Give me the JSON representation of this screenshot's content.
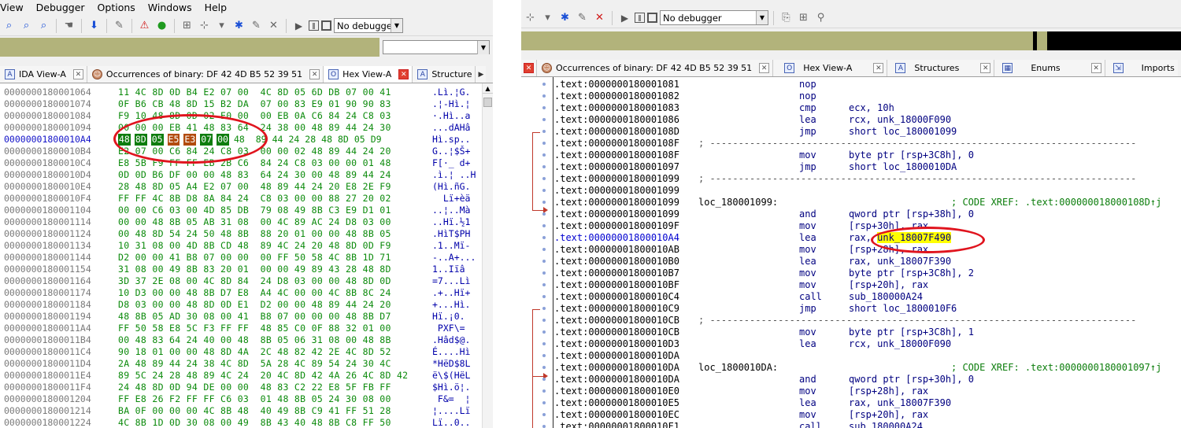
{
  "left": {
    "menu": [
      "View",
      "Debugger",
      "Options",
      "Windows",
      "Help"
    ],
    "debugger_select": "No debugger",
    "tabs": [
      {
        "label": "IDA View-A",
        "icon": "A"
      },
      {
        "label": "Occurrences of binary: DF 42 4D B5 52 39 51",
        "icon": "face"
      },
      {
        "label": "Hex View-A",
        "icon": "H"
      },
      {
        "label": "Structure",
        "icon": "A"
      }
    ],
    "hex_rows": [
      {
        "addr": "0000000180001064",
        "bytes": "11 4C 8D 0D B4 E2 07 00  4C 8D 05 6D DB 07 00 41",
        "ascii": ".Lì.¦G."
      },
      {
        "addr": "0000000180001074",
        "bytes": "0F B6 CB 48 8D 15 B2 DA  07 00 83 E9 01 90 90 83",
        "ascii": ".¦-Hì.¦"
      },
      {
        "addr": "0000000180001084",
        "bytes": "F9 10 48 8D 0D 02 E0 00  00 EB 0A C6 84 24 C8 03",
        "ascii": "·.Hì..a"
      },
      {
        "addr": "0000000180001094",
        "bytes": "00 00 00 EB 41 48 83 64  24 38 00 48 89 44 24 30",
        "ascii": "...dAHâ"
      },
      {
        "addr": "00000001800010A4",
        "bytes": "48 8D 05 E5 E3 07 00 48  89 44 24 28 48 8D 05 D9",
        "ascii": "Hì.sp..",
        "selected": true
      },
      {
        "addr": "00000001800010B4",
        "bytes": "E2 07 00 C6 84 24 C8 03  00 00 02 48 89 44 24 20",
        "ascii": "G..¦$Š+"
      },
      {
        "addr": "00000001800010C4",
        "bytes": "E8 5B F9 FF FF EB 2B C6  84 24 C8 03 00 00 01 48",
        "ascii": "F[·_ d+"
      },
      {
        "addr": "00000001800010D4",
        "bytes": "0D 0D B6 DF 00 00 48 83  64 24 30 00 48 89 44 24",
        "ascii": ".ì.¦ ..H"
      },
      {
        "addr": "00000001800010E4",
        "bytes": "28 48 8D 05 A4 E2 07 00  48 89 44 24 20 E8 2E F9",
        "ascii": "(Hì.ñG."
      },
      {
        "addr": "00000001800010F4",
        "bytes": "FF FF 4C 8B D8 8A 84 24  C8 03 00 00 88 27 20 02",
        "ascii": "  Lï+èä"
      },
      {
        "addr": "0000000180001104",
        "bytes": "00 00 C6 03 00 4D 85 DB  79 08 49 8B C3 E9 D1 01",
        "ascii": "..¦..Mà"
      },
      {
        "addr": "0000000180001114",
        "bytes": "00 00 48 8B 05 AB 31 08  00 4C 89 AC 24 D8 03 00",
        "ascii": "..Hï.½1"
      },
      {
        "addr": "0000000180001124",
        "bytes": "00 48 8D 54 24 50 48 8B  88 20 01 00 00 48 8B 05",
        "ascii": ".HìT$PH"
      },
      {
        "addr": "0000000180001134",
        "bytes": "10 31 08 00 4D 8B CD 48  89 4C 24 20 48 8D 0D F9",
        "ascii": ".1..Mï-"
      },
      {
        "addr": "0000000180001144",
        "bytes": "D2 00 00 41 B8 07 00 00  00 FF 50 58 4C 8B 1D 71",
        "ascii": "-..A+..."
      },
      {
        "addr": "0000000180001154",
        "bytes": "31 08 00 49 8B 83 20 01  00 00 49 89 43 28 48 8D",
        "ascii": "1..Iïâ"
      },
      {
        "addr": "0000000180001164",
        "bytes": "3D 37 2E 08 00 4C 8D 84  24 D8 03 00 00 48 8D 0D",
        "ascii": "=7...Lì"
      },
      {
        "addr": "0000000180001174",
        "bytes": "10 D3 00 00 48 8B D7 E8  A4 4C 00 00 4C 8B 8C 24",
        "ascii": ".+..Hï+"
      },
      {
        "addr": "0000000180001184",
        "bytes": "D8 03 00 00 48 8D 0D E1  D2 00 00 48 89 44 24 20",
        "ascii": "+...Hì."
      },
      {
        "addr": "0000000180001194",
        "bytes": "48 8B 05 AD 30 08 00 41  B8 07 00 00 00 48 8B D7",
        "ascii": "Hï.¡0."
      },
      {
        "addr": "00000001800011A4",
        "bytes": "FF 50 58 E8 5C F3 FF FF  48 85 C0 0F 88 32 01 00",
        "ascii": " PXF\\="
      },
      {
        "addr": "00000001800011B4",
        "bytes": "00 48 83 64 24 40 00 48  8B 05 06 31 08 00 48 8B",
        "ascii": ".Hâd$@."
      },
      {
        "addr": "00000001800011C4",
        "bytes": "90 18 01 00 00 48 8D 4A  2C 48 82 42 2E 4C 8D 52",
        "ascii": "É....Hì"
      },
      {
        "addr": "00000001800011D4",
        "bytes": "2A 48 89 44 24 38 4C 8D  5A 28 4C 89 54 24 30 4C",
        "ascii": "*HëD$8L"
      },
      {
        "addr": "00000001800011E4",
        "bytes": "89 5C 24 28 48 89 4C 24  20 4C 8D 42 4A 26 4C 8D 42",
        "ascii": "ë\\$(HëL"
      },
      {
        "addr": "00000001800011F4",
        "bytes": "24 48 8D 0D 94 DE 00 00  48 83 C2 22 E8 5F FB FF",
        "ascii": "$Hì.ö¦."
      },
      {
        "addr": "0000000180001204",
        "bytes": "FF E8 26 F2 FF FF C6 03  01 48 8B 05 24 30 08 00",
        "ascii": " F&=  ¦"
      },
      {
        "addr": "0000000180001214",
        "bytes": "BA 0F 00 00 00 4C 8B 48  40 49 8B C9 41 FF 51 28",
        "ascii": "¦....Lï"
      },
      {
        "addr": "0000000180001224",
        "bytes": "4C 8B 1D 0D 30 08 00 49  8B 43 40 48 8B C8 FF 50",
        "ascii": "Lï..0.."
      }
    ]
  },
  "right": {
    "debugger_select": "No debugger",
    "tabs": [
      {
        "label": "Occurrences of binary: DF 42 4D B5 52 39 51",
        "icon": "face"
      },
      {
        "label": "Hex View-A",
        "icon": "O"
      },
      {
        "label": "Structures",
        "icon": "A"
      },
      {
        "label": "Enums",
        "icon": "grid"
      },
      {
        "label": "Imports",
        "icon": "imp"
      }
    ],
    "disasm_rows": [
      {
        "addr": ".text:0000000180001081",
        "mnem": "nop",
        "ops": ""
      },
      {
        "addr": ".text:0000000180001082",
        "mnem": "nop",
        "ops": ""
      },
      {
        "addr": ".text:0000000180001083",
        "mnem": "cmp",
        "ops": "ecx, 10h"
      },
      {
        "addr": ".text:0000000180001086",
        "mnem": "lea",
        "ops": "rcx, unk_18000F090"
      },
      {
        "addr": ".text:000000018000108D",
        "mnem": "jmp",
        "ops": "short loc_180001099"
      },
      {
        "addr": ".text:000000018000108F",
        "sep": "; ---------------------------------------------------------------------------"
      },
      {
        "addr": ".text:000000018000108F",
        "mnem": "mov",
        "ops": "byte ptr [rsp+3C8h], 0"
      },
      {
        "addr": ".text:0000000180001097",
        "mnem": "jmp",
        "ops": "short loc_1800010DA"
      },
      {
        "addr": ".text:0000000180001099",
        "sep": "; ---------------------------------------------------------------------------"
      },
      {
        "addr": ".text:0000000180001099",
        "mnem": "",
        "ops": ""
      },
      {
        "addr": ".text:0000000180001099",
        "label": "loc_180001099:",
        "comment": "; CODE XREF: .text:000000018000108D↑j"
      },
      {
        "addr": ".text:0000000180001099",
        "mnem": "and",
        "ops": "qword ptr [rsp+38h], 0"
      },
      {
        "addr": ".text:000000018000109F",
        "mnem": "mov",
        "ops": "[rsp+30h], rax"
      },
      {
        "addr": ".text:00000001800010A4",
        "mnem": "lea",
        "ops_pre": "rax, ",
        "ops_hl": "unk_18007F490",
        "current": true
      },
      {
        "addr": ".text:00000001800010AB",
        "mnem": "mov",
        "ops": "[rsp+28h], rax"
      },
      {
        "addr": ".text:00000001800010B0",
        "mnem": "lea",
        "ops": "rax, unk_18007F390"
      },
      {
        "addr": ".text:00000001800010B7",
        "mnem": "mov",
        "ops": "byte ptr [rsp+3C8h], 2"
      },
      {
        "addr": ".text:00000001800010BF",
        "mnem": "mov",
        "ops": "[rsp+20h], rax"
      },
      {
        "addr": ".text:00000001800010C4",
        "mnem": "call",
        "ops": "sub_180000A24"
      },
      {
        "addr": ".text:00000001800010C9",
        "mnem": "jmp",
        "ops": "short loc_1800010F6"
      },
      {
        "addr": ".text:00000001800010CB",
        "sep": "; ---------------------------------------------------------------------------"
      },
      {
        "addr": ".text:00000001800010CB",
        "mnem": "mov",
        "ops": "byte ptr [rsp+3C8h], 1"
      },
      {
        "addr": ".text:00000001800010D3",
        "mnem": "lea",
        "ops": "rcx, unk_18000F090"
      },
      {
        "addr": ".text:00000001800010DA",
        "mnem": "",
        "ops": ""
      },
      {
        "addr": ".text:00000001800010DA",
        "label": "loc_1800010DA:",
        "comment": "; CODE XREF: .text:0000000180001097↑j"
      },
      {
        "addr": ".text:00000001800010DA",
        "mnem": "and",
        "ops": "qword ptr [rsp+30h], 0"
      },
      {
        "addr": ".text:00000001800010E0",
        "mnem": "mov",
        "ops": "[rsp+28h], rax"
      },
      {
        "addr": ".text:00000001800010E5",
        "mnem": "lea",
        "ops": "rax, unk_18007F390"
      },
      {
        "addr": ".text:00000001800010EC",
        "mnem": "mov",
        "ops": "[rsp+20h], rax"
      },
      {
        "addr": ".text:00000001800010F1",
        "mnem": "call",
        "ops": "sub_180000A24"
      }
    ]
  }
}
